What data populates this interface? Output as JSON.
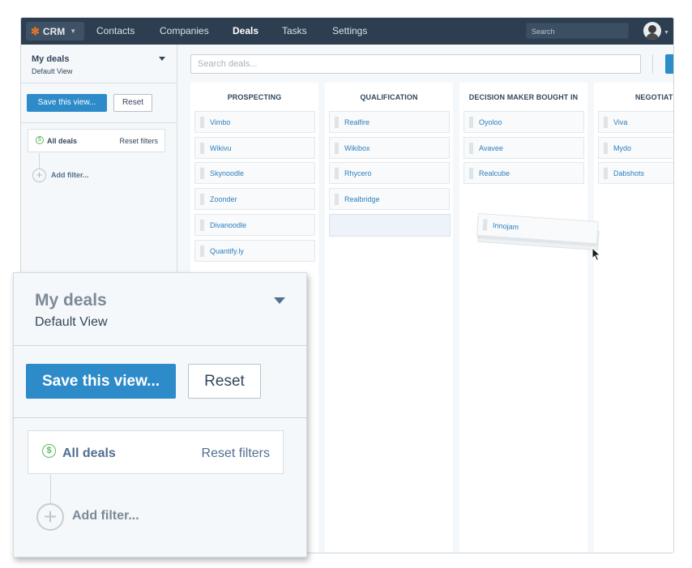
{
  "topbar": {
    "crm_label": "CRM",
    "nav": [
      "Contacts",
      "Companies",
      "Deals",
      "Tasks",
      "Settings"
    ],
    "active_nav": "Deals",
    "search_placeholder": "Search"
  },
  "sidebar": {
    "title": "My deals",
    "subtitle": "Default View",
    "save_label": "Save this view...",
    "reset_label": "Reset",
    "filter_label": "All deals",
    "reset_filters_label": "Reset filters",
    "add_filter_label": "Add filter..."
  },
  "board": {
    "search_placeholder": "Search deals...",
    "columns": [
      {
        "title": "PROSPECTING",
        "deals": [
          "Vimbo",
          "Wikivu",
          "Skynoodle",
          "Zoonder",
          "Divanoodle",
          "Quantify.ly"
        ]
      },
      {
        "title": "QUALIFICATION",
        "deals": [
          "Realfire",
          "Wikibox",
          "Rhycero",
          "Realbridge"
        ]
      },
      {
        "title": "DECISION MAKER BOUGHT IN",
        "deals": [
          "Oyoloo",
          "Avavee",
          "Realcube"
        ]
      },
      {
        "title": "NEGOTIATIO",
        "deals": [
          "Viva",
          "Mydo",
          "Dabshots"
        ]
      }
    ],
    "dragging_deal": "Innojam"
  },
  "zoom_panel": {
    "title": "My deals",
    "subtitle": "Default View",
    "save_label": "Save this view...",
    "reset_label": "Reset",
    "filter_label": "All deals",
    "reset_filters_label": "Reset filters",
    "add_filter_label": "Add filter..."
  },
  "colors": {
    "topbar": "#2d3e50",
    "primary_button": "#2d8bc9",
    "link": "#2d7fbf",
    "crm_logo": "#f57722",
    "dollar_icon": "#5fb85f"
  }
}
